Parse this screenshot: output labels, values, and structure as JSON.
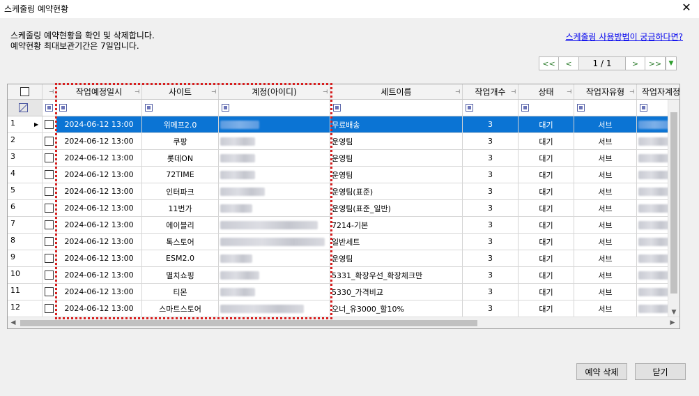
{
  "window": {
    "title": "스케줄링 예약현황",
    "close_glyph": "✕"
  },
  "description": {
    "line1": "스케줄링 예약현황을 확인 및 삭제합니다.",
    "line2": "예약현황 최대보관기간은 7일입니다."
  },
  "help_link": "스케줄링 사용방법이 궁금하다면?",
  "pager": {
    "first": "<<",
    "prev": "<",
    "info": "1 / 1",
    "next": ">",
    "last": ">>",
    "menu_glyph": "▼"
  },
  "columns": [
    "작업예정일시",
    "사이트",
    "계정(아이디)",
    "세트이름",
    "작업개수",
    "상태",
    "작업자유형",
    "작업자계정"
  ],
  "rows": [
    {
      "no": "1",
      "datetime": "2024-06-12 13:00",
      "site": "위메프2.0",
      "set": "무료배송",
      "count": "3",
      "status": "대기",
      "worker_type": "서브"
    },
    {
      "no": "2",
      "datetime": "2024-06-12 13:00",
      "site": "쿠팡",
      "set": "운영팀",
      "count": "3",
      "status": "대기",
      "worker_type": "서브"
    },
    {
      "no": "3",
      "datetime": "2024-06-12 13:00",
      "site": "롯데ON",
      "set": "운영팀",
      "count": "3",
      "status": "대기",
      "worker_type": "서브"
    },
    {
      "no": "4",
      "datetime": "2024-06-12 13:00",
      "site": "72TIME",
      "set": "운영팀",
      "count": "3",
      "status": "대기",
      "worker_type": "서브"
    },
    {
      "no": "5",
      "datetime": "2024-06-12 13:00",
      "site": "인터파크",
      "set": "운영팀(표준)",
      "count": "3",
      "status": "대기",
      "worker_type": "서브"
    },
    {
      "no": "6",
      "datetime": "2024-06-12 13:00",
      "site": "11번가",
      "set": "운영팀(표준_일반)",
      "count": "3",
      "status": "대기",
      "worker_type": "서브"
    },
    {
      "no": "7",
      "datetime": "2024-06-12 13:00",
      "site": "에이블리",
      "set": "7214-기본",
      "count": "3",
      "status": "대기",
      "worker_type": "서브"
    },
    {
      "no": "8",
      "datetime": "2024-06-12 13:00",
      "site": "톡스토어",
      "set": "일반세트",
      "count": "3",
      "status": "대기",
      "worker_type": "서브"
    },
    {
      "no": "9",
      "datetime": "2024-06-12 13:00",
      "site": "ESM2.0",
      "set": "운영팀",
      "count": "3",
      "status": "대기",
      "worker_type": "서브"
    },
    {
      "no": "10",
      "datetime": "2024-06-12 13:00",
      "site": "멸치쇼핑",
      "set": "5331_확장우선_확장체크만",
      "count": "3",
      "status": "대기",
      "worker_type": "서브"
    },
    {
      "no": "11",
      "datetime": "2024-06-12 13:00",
      "site": "티몬",
      "set": "5330_가격비교",
      "count": "3",
      "status": "대기",
      "worker_type": "서브"
    },
    {
      "no": "12",
      "datetime": "2024-06-12 13:00",
      "site": "스마트스토어",
      "set": "오너_유3000_할10%",
      "count": "3",
      "status": "대기",
      "worker_type": "서브"
    }
  ],
  "buttons": {
    "delete": "예약 삭제",
    "close": "닫기"
  },
  "colors": {
    "selected_row": "#0b74d4",
    "highlight_border": "#d81e1e",
    "link": "#0000ee",
    "pager_text": "#2d7d2d"
  }
}
